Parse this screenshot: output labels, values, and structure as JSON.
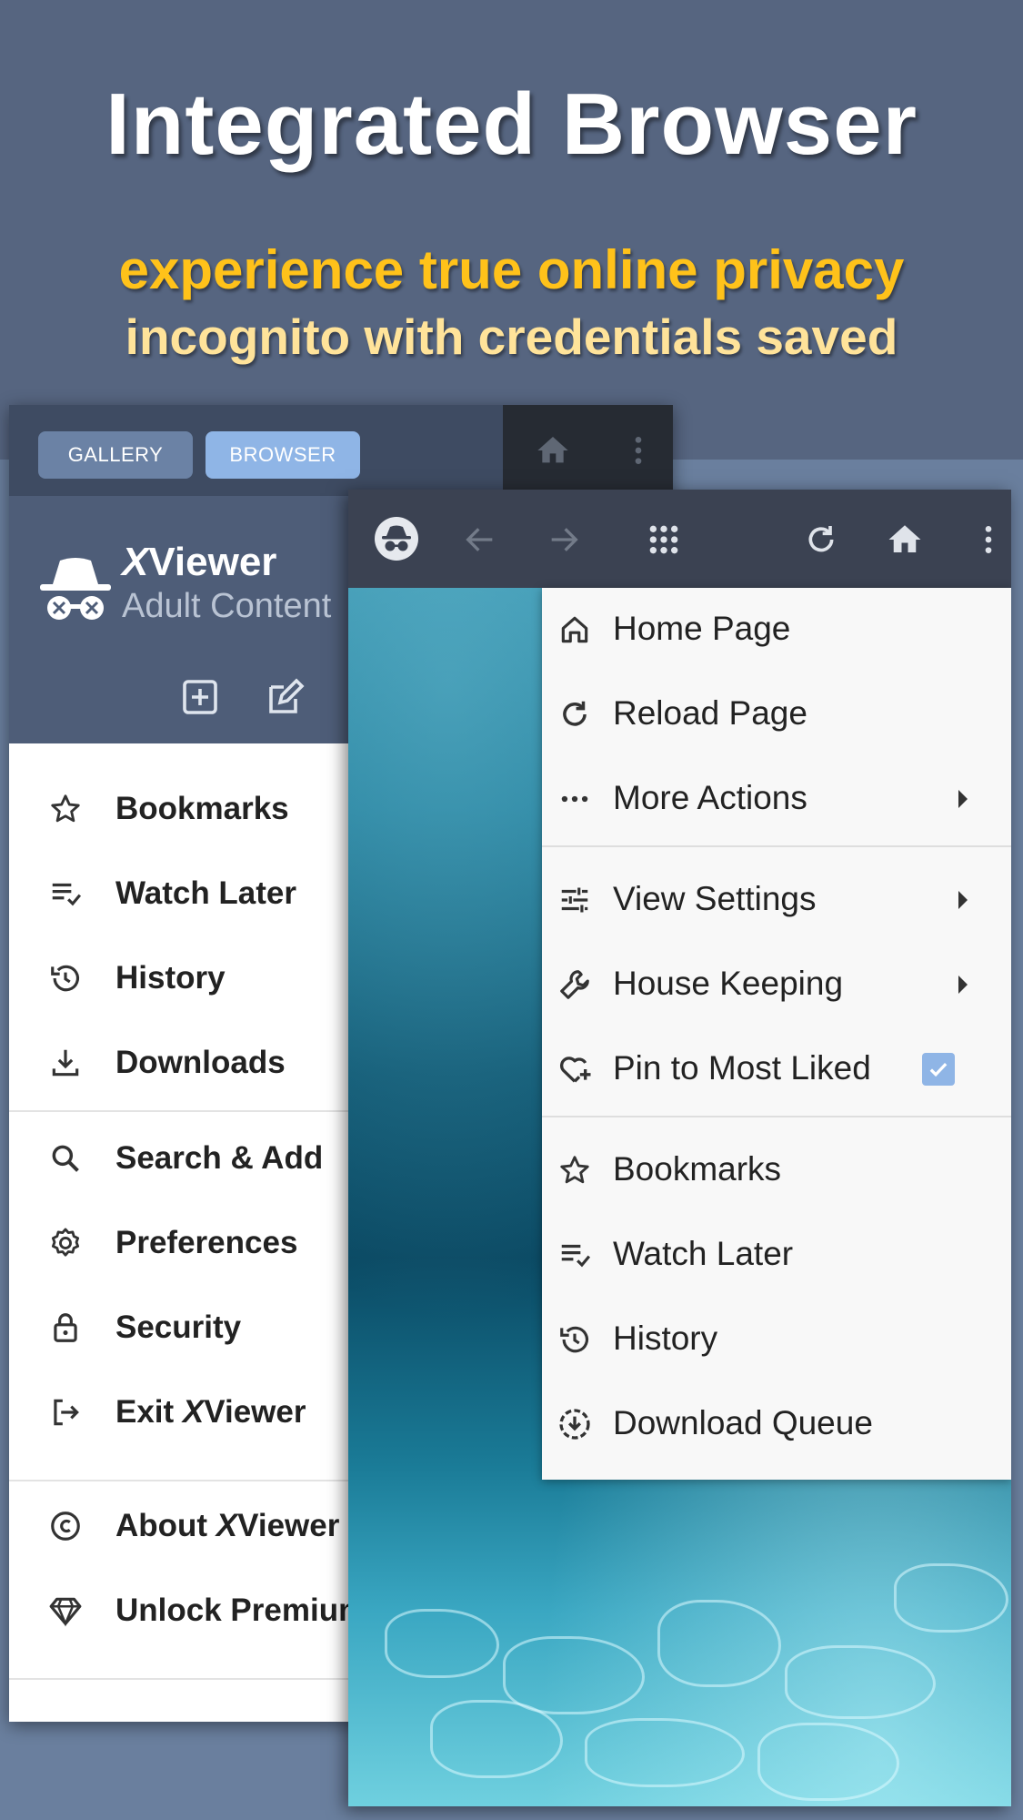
{
  "promo": {
    "headline": "Integrated Browser",
    "sub1": "experience true online privacy",
    "sub2": "incognito with credentials saved"
  },
  "drawer": {
    "tabs": {
      "gallery": "GALLERY",
      "browser": "BROWSER"
    },
    "app_name_prefix": "X",
    "app_name_rest": "Viewer",
    "app_subtitle": "Adult Content",
    "items": [
      {
        "label": "Bookmarks",
        "icon": "star-icon"
      },
      {
        "label": "Watch Later",
        "icon": "playlist-check-icon"
      },
      {
        "label": "History",
        "icon": "history-icon"
      },
      {
        "label": "Downloads",
        "icon": "download-icon"
      },
      {
        "label": "Search & Add",
        "icon": "search-icon"
      },
      {
        "label": "Preferences",
        "icon": "gear-icon"
      },
      {
        "label": "Security",
        "icon": "lock-icon"
      },
      {
        "label": "Exit ",
        "label_italic": "X",
        "label_rest": "Viewer",
        "icon": "exit-icon"
      },
      {
        "label": "About ",
        "label_italic": "X",
        "label_rest": "Viewer",
        "icon": "copyright-icon"
      },
      {
        "label": "Unlock Premium",
        "icon": "diamond-icon"
      }
    ]
  },
  "browser_menu": {
    "items": [
      {
        "label": "Home Page",
        "icon": "home-outline-icon"
      },
      {
        "label": "Reload Page",
        "icon": "reload-icon"
      },
      {
        "label": "More Actions",
        "icon": "dots-horizontal-icon",
        "submenu": true
      },
      {
        "label": "View Settings",
        "icon": "tune-icon",
        "submenu": true
      },
      {
        "label": "House Keeping",
        "icon": "wrench-icon",
        "submenu": true
      },
      {
        "label": "Pin to Most Liked",
        "icon": "heart-plus-icon",
        "checked": true
      },
      {
        "label": "Bookmarks",
        "icon": "star-icon"
      },
      {
        "label": "Watch Later",
        "icon": "playlist-check-icon"
      },
      {
        "label": "History",
        "icon": "history-icon"
      },
      {
        "label": "Download Queue",
        "icon": "download-circle-icon"
      }
    ]
  },
  "colors": {
    "accent_blue": "#8fb5e6",
    "headline_yellow": "#ffc21a",
    "subtitle_yellow": "#ffe39a",
    "toolbar": "#3b4252"
  }
}
